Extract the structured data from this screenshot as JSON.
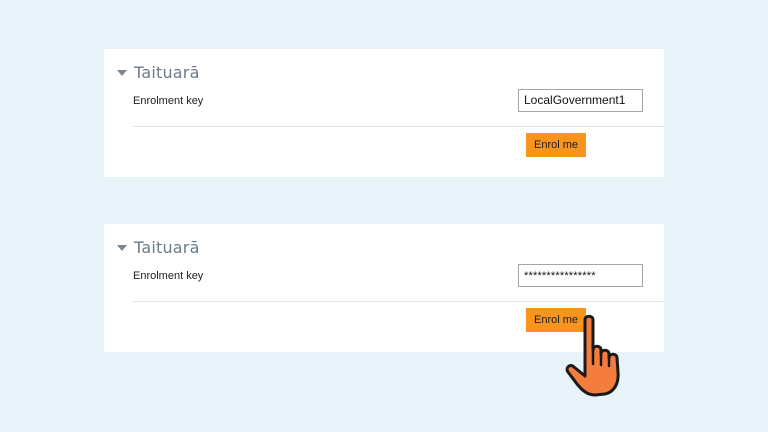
{
  "panels": [
    {
      "section_title": "Taituarā",
      "field_label": "Enrolment key",
      "key_value": "LocalGovernment1",
      "button_label": "Enrol me"
    },
    {
      "section_title": "Taituarā",
      "field_label": "Enrolment key",
      "key_value": "****************",
      "button_label": "Enrol me"
    }
  ],
  "colors": {
    "page_background": "#e8f3f9",
    "button": "#f7941e",
    "hand_fill": "#f47c3c",
    "title": "#6c7a89"
  },
  "icons": {
    "section_toggle": "caret-down-icon",
    "pointer": "pointing-hand-icon"
  }
}
